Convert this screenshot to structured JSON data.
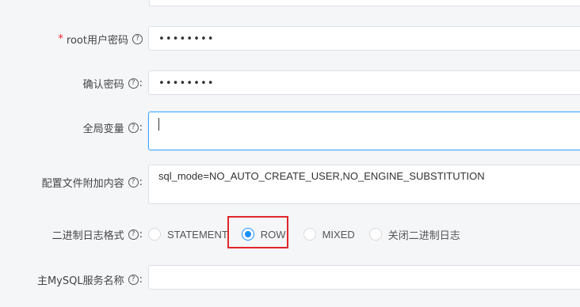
{
  "form": {
    "root_password": {
      "label": "root用户密码",
      "required_mark": "*",
      "value": "••••••••",
      "help": "?",
      "colon": ":"
    },
    "confirm_password": {
      "label": "确认密码",
      "value": "••••••••",
      "help": "?",
      "colon": ":"
    },
    "global_vars": {
      "label": "全局变量",
      "value": "",
      "help": "?",
      "colon": ":"
    },
    "config_append": {
      "label": "配置文件附加内容",
      "value": "sql_mode=NO_AUTO_CREATE_USER,NO_ENGINE_SUBSTITUTION",
      "help": "?",
      "colon": ":"
    },
    "binlog_format": {
      "label": "二进制日志格式",
      "help": "?",
      "colon": ":",
      "selected": "ROW",
      "options": [
        "STATEMENT",
        "ROW",
        "MIXED",
        "关闭二进制日志"
      ]
    },
    "master_service": {
      "label": "主MySQL服务名称",
      "value": "",
      "help": "?",
      "colon": ":"
    }
  },
  "colors": {
    "accent": "#1890ff",
    "highlight": "#e0262b",
    "required": "#f5222d"
  }
}
